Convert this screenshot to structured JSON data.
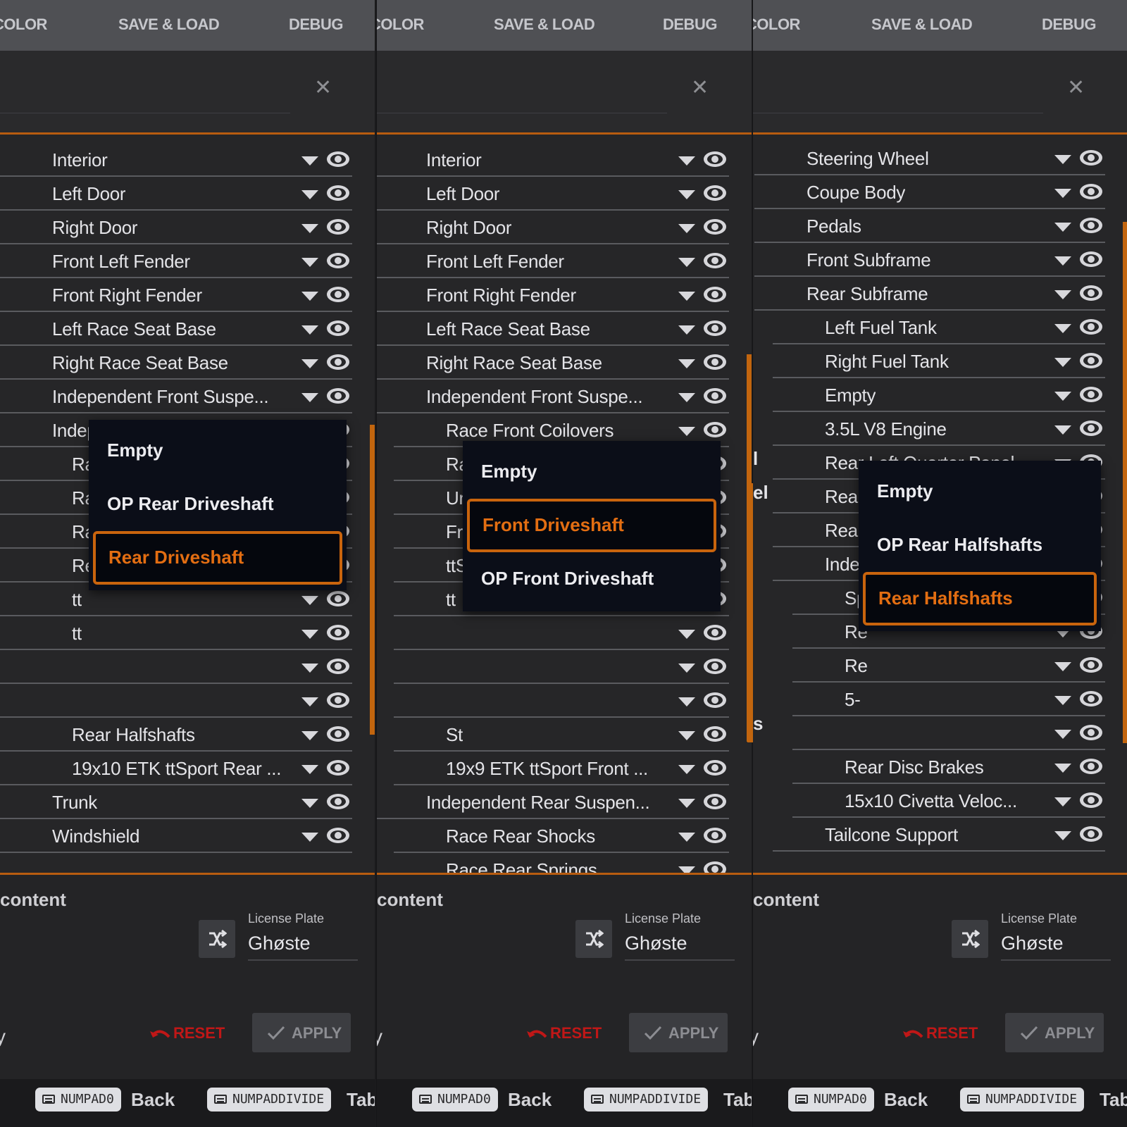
{
  "tabs": [
    "COLOR",
    "SAVE & LOAD",
    "DEBUG"
  ],
  "common": {
    "content_label": "content",
    "license_plate_label": "License Plate",
    "license_plate_value": "Ghøste",
    "reset_label": "RESET",
    "apply_label": "APPLY",
    "key_back": "NUMPAD0",
    "key_back_caption": "Back",
    "key_tab": "NUMPADDIVIDE",
    "key_tab_caption": "Tab",
    "cut_left_text": "y"
  },
  "panels": [
    {
      "rows": [
        {
          "label": "Interior",
          "indent": 0
        },
        {
          "label": "Left Door",
          "indent": 0
        },
        {
          "label": "Right Door",
          "indent": 0
        },
        {
          "label": "Front Left Fender",
          "indent": 0
        },
        {
          "label": "Front Right Fender",
          "indent": 0
        },
        {
          "label": "Left Race Seat Base",
          "indent": 0
        },
        {
          "label": "Right Race Seat Base",
          "indent": 0
        },
        {
          "label": "Independent Front Suspe...",
          "indent": 0
        },
        {
          "label": "Independent Rear Suspen...",
          "indent": 0
        },
        {
          "label": "Race Rear Shocks",
          "indent": 1
        },
        {
          "label": "Race Rear Springs",
          "indent": 1
        },
        {
          "label": "Race Rear Sway Bar",
          "indent": 1
        },
        {
          "label": "Re",
          "indent": 1
        },
        {
          "label": "tt",
          "indent": 1
        },
        {
          "label": "tt",
          "indent": 1
        },
        {
          "label": "",
          "indent": 1
        },
        {
          "label": "",
          "indent": 1
        },
        {
          "label": "Rear Halfshafts",
          "indent": 1
        },
        {
          "label": "19x10 ETK ttSport Rear ...",
          "indent": 1
        },
        {
          "label": "Trunk",
          "indent": 0
        },
        {
          "label": "Windshield",
          "indent": 0
        }
      ],
      "dropdown": [
        "Empty",
        "OP Rear Driveshaft",
        "Rear Driveshaft"
      ],
      "selected": 2
    },
    {
      "rows": [
        {
          "label": "Interior",
          "indent": 0
        },
        {
          "label": "Left Door",
          "indent": 0
        },
        {
          "label": "Right Door",
          "indent": 0
        },
        {
          "label": "Front Left Fender",
          "indent": 0
        },
        {
          "label": "Front Right Fender",
          "indent": 0
        },
        {
          "label": "Left Race Seat Base",
          "indent": 0
        },
        {
          "label": "Right Race Seat Base",
          "indent": 0
        },
        {
          "label": "Independent Front Suspe...",
          "indent": 0
        },
        {
          "label": "Race Front Coilovers",
          "indent": 1
        },
        {
          "label": "Race Front Sway Bar",
          "indent": 1
        },
        {
          "label": "Undertray",
          "indent": 1
        },
        {
          "label": "Front Spindles",
          "indent": 1
        },
        {
          "label": "ttSport Carbon-Ceramic ...",
          "indent": 1
        },
        {
          "label": "tt",
          "indent": 1
        },
        {
          "label": "",
          "indent": 1
        },
        {
          "label": "",
          "indent": 1
        },
        {
          "label": "",
          "indent": 1
        },
        {
          "label": "St",
          "indent": 1
        },
        {
          "label": "19x9 ETK ttSport Front ...",
          "indent": 1
        },
        {
          "label": "Independent Rear Suspen...",
          "indent": 0
        },
        {
          "label": "Race Rear Shocks",
          "indent": 1
        },
        {
          "label": "Race Rear Springs",
          "indent": 1
        }
      ],
      "dropdown": [
        "Empty",
        "Front Driveshaft",
        "OP Front Driveshaft"
      ],
      "selected": 1
    },
    {
      "rows": [
        {
          "label": "Steering Wheel",
          "indent": 1
        },
        {
          "label": "Coupe Body",
          "indent": 1
        },
        {
          "label": "Pedals",
          "indent": 1
        },
        {
          "label": "Front Subframe",
          "indent": 1
        },
        {
          "label": "Rear Subframe",
          "indent": 1
        },
        {
          "label": "Left Fuel Tank",
          "indent": 2
        },
        {
          "label": "Right Fuel Tank",
          "indent": 2
        },
        {
          "label": "Empty",
          "indent": 2
        },
        {
          "label": "3.5L V8 Engine",
          "indent": 2
        },
        {
          "label": "Rear Left Quarter Panel",
          "indent": 2
        },
        {
          "label": "Rear Right Quarter Panel",
          "indent": 2
        },
        {
          "label": "Rear Body",
          "indent": 2
        },
        {
          "label": "Independent Rear Susp...",
          "indent": 2
        },
        {
          "label": "Sp",
          "indent": 3
        },
        {
          "label": "Re",
          "indent": 3
        },
        {
          "label": "Re",
          "indent": 3
        },
        {
          "label": "5-",
          "indent": 3
        },
        {
          "label": "",
          "indent": 3
        },
        {
          "label": "Rear Disc Brakes",
          "indent": 3
        },
        {
          "label": "15x10 Civetta Veloc...",
          "indent": 3
        },
        {
          "label": "Tailcone Support",
          "indent": 2
        }
      ],
      "dropdown": [
        "Empty",
        "OP Rear Halfshafts",
        "Rear Halfshafts"
      ],
      "selected": 2,
      "left_stubs": [
        "l",
        "el",
        "s"
      ]
    }
  ],
  "colors": {
    "accent": "#c2650e",
    "selected_text": "#e36e12",
    "reset": "#c01717"
  }
}
